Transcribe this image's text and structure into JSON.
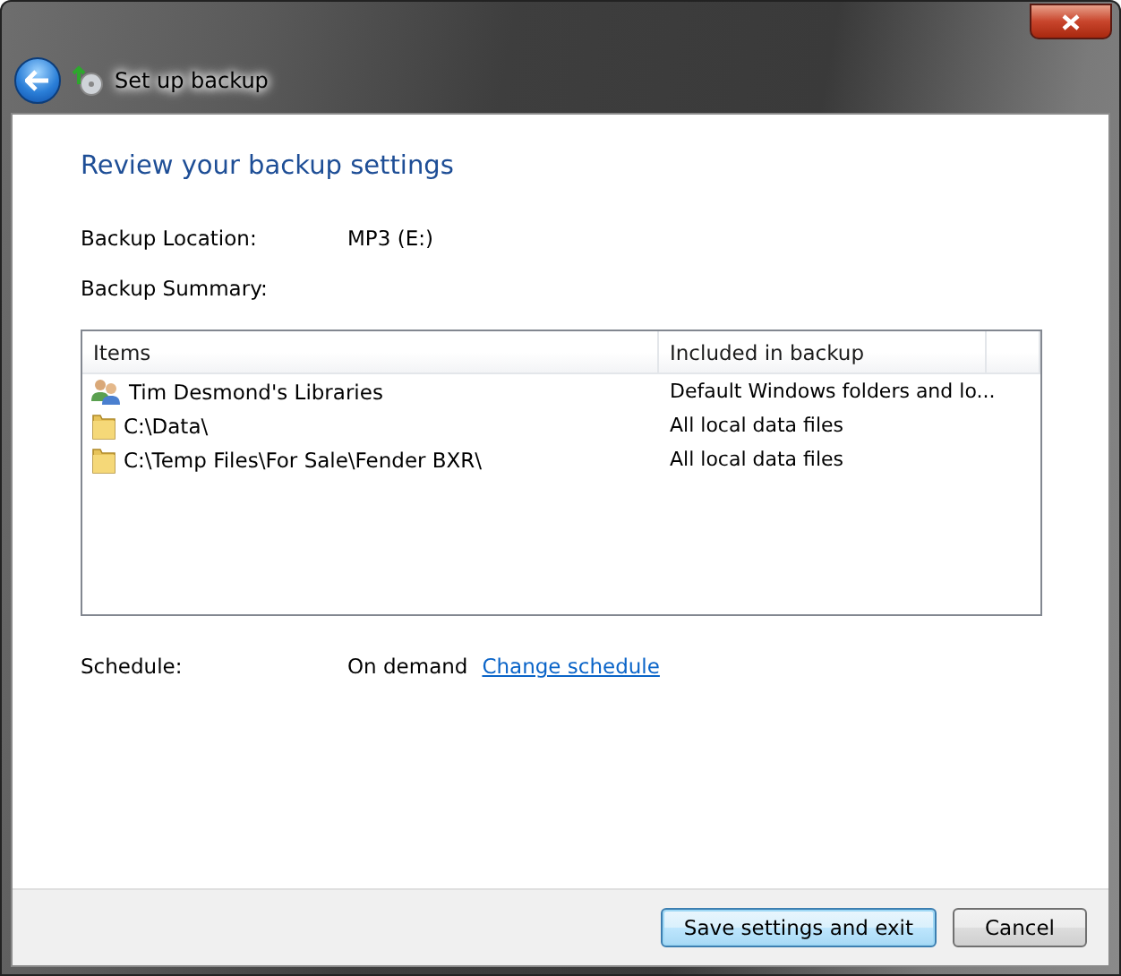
{
  "window": {
    "title": "Set up backup"
  },
  "heading": "Review your backup settings",
  "location": {
    "label": "Backup Location:",
    "value": "MP3 (E:)"
  },
  "summary_label": "Backup Summary:",
  "table": {
    "columns": [
      "Items",
      "Included in backup"
    ],
    "rows": [
      {
        "kind": "libraries",
        "item": "Tim Desmond's Libraries",
        "included": "Default Windows folders and lo..."
      },
      {
        "kind": "folder",
        "item": "C:\\Data\\",
        "included": "All local data files"
      },
      {
        "kind": "folder",
        "item": "C:\\Temp Files\\For Sale\\Fender BXR\\",
        "included": "All local data files"
      }
    ]
  },
  "schedule": {
    "label": "Schedule:",
    "value": "On demand",
    "link": "Change schedule"
  },
  "buttons": [
    {
      "label": "Save settings and exit",
      "kind": "default"
    },
    {
      "label": "Cancel",
      "kind": "normal"
    }
  ]
}
